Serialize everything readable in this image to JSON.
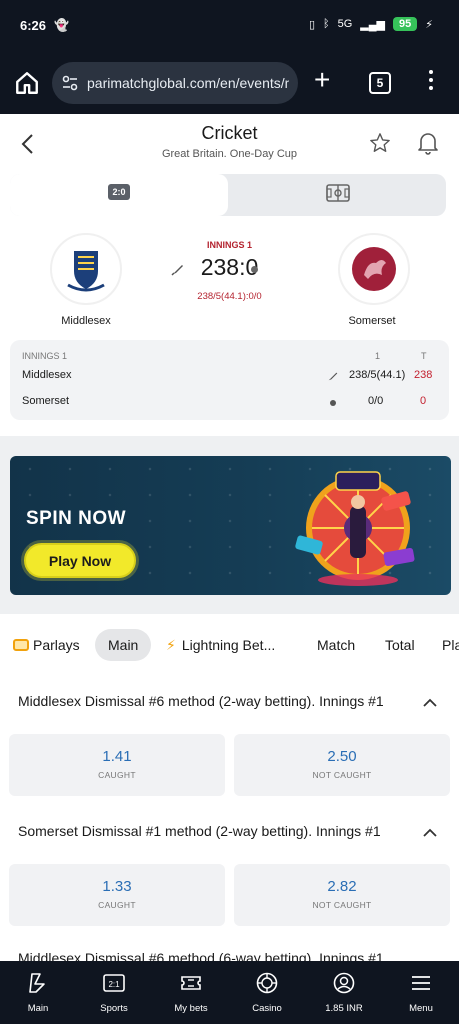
{
  "status_bar": {
    "time": "6:26",
    "battery": "95",
    "network": "5G"
  },
  "browser": {
    "url": "parimatchglobal.com/en/events/mi",
    "tab_count": "5"
  },
  "header": {
    "title": "Cricket",
    "subtitle": "Great Britain. One-Day Cup"
  },
  "scoreboard": {
    "toggle_score_label": "2:0",
    "innings_label": "INNINGS 1",
    "score": "238:0",
    "detail": "238/5(44.1):0/0",
    "home_team": "Middlesex",
    "away_team": "Somerset"
  },
  "innings_table": {
    "title": "INNINGS 1",
    "col1": "1",
    "col2": "T",
    "rows": [
      {
        "team": "Middlesex",
        "value": "238/5(44.1)",
        "total": "238"
      },
      {
        "team": "Somerset",
        "value": "0/0",
        "total": "0"
      }
    ]
  },
  "banner": {
    "headline": "SPIN NOW",
    "button": "Play Now"
  },
  "tabs": [
    "Parlays",
    "Main",
    "Lightning Bet...",
    "Match",
    "Total",
    "Pla"
  ],
  "markets": [
    {
      "title": "Middlesex Dismissal #6 method (2-way betting). Innings #1",
      "odds": [
        {
          "value": "1.41",
          "label": "CAUGHT"
        },
        {
          "value": "2.50",
          "label": "NOT CAUGHT"
        }
      ]
    },
    {
      "title": "Somerset Dismissal #1 method (2-way betting). Innings #1",
      "odds": [
        {
          "value": "1.33",
          "label": "CAUGHT"
        },
        {
          "value": "2.82",
          "label": "NOT CAUGHT"
        }
      ]
    },
    {
      "title": "Middlesex Dismissal #6 method (6-way betting). Innings #1"
    }
  ],
  "bottom_nav": [
    {
      "label": "Main",
      "icon": "home-logo-icon"
    },
    {
      "label": "Sports",
      "icon": "scoreboard-icon"
    },
    {
      "label": "My bets",
      "icon": "ticket-icon"
    },
    {
      "label": "Casino",
      "icon": "casino-chip-icon"
    },
    {
      "label": "1.85 INR",
      "icon": "account-icon"
    },
    {
      "label": "Menu",
      "icon": "menu-icon"
    }
  ],
  "colors": {
    "accent_red": "#c3202f",
    "odds_blue": "#2a6eb5",
    "banner_yellow": "#f2e92a",
    "dark_bg": "#0f1520"
  }
}
